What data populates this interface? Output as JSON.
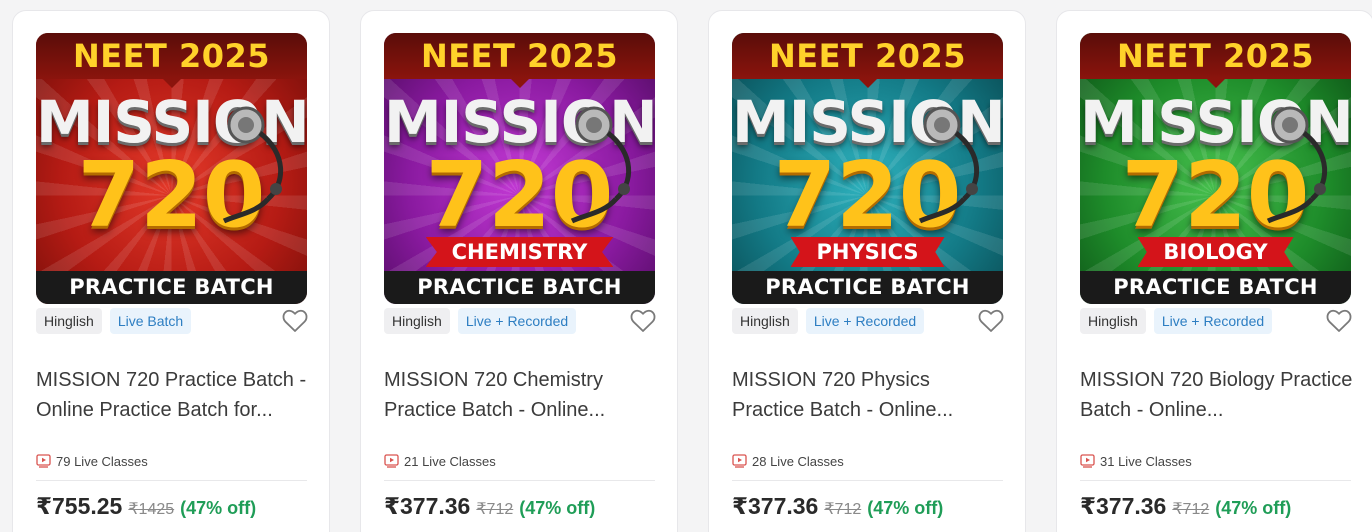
{
  "colors": {
    "card_1_theme": "#b51b14",
    "card_2_theme": "#8a1aa0",
    "card_3_theme": "#137a86",
    "card_4_theme": "#1e8c2a",
    "live_tag_text": "#2d7ec2",
    "discount_text": "#1f9d57"
  },
  "cards": [
    {
      "thumb": {
        "top": "NEET 2025",
        "line1": "MISSION",
        "line2": "720",
        "subject": "",
        "bottom": "PRACTICE BATCH"
      },
      "language_tag": "Hinglish",
      "mode_tag": "Live Batch",
      "title": "MISSION 720 Practice Batch - Online Practice Batch for...",
      "classes_icon": "video-play-icon",
      "classes": "79 Live Classes",
      "price": "₹755.25",
      "original_price": "₹1425",
      "discount": "(47% off)",
      "wishlist_icon": "heart-outline-icon"
    },
    {
      "thumb": {
        "top": "NEET 2025",
        "line1": "MISSION",
        "line2": "720",
        "subject": "CHEMISTRY",
        "bottom": "PRACTICE BATCH"
      },
      "language_tag": "Hinglish",
      "mode_tag": "Live + Recorded",
      "title": "MISSION 720 Chemistry Practice Batch - Online...",
      "classes_icon": "video-play-icon",
      "classes": "21 Live Classes",
      "price": "₹377.36",
      "original_price": "₹712",
      "discount": "(47% off)",
      "wishlist_icon": "heart-outline-icon"
    },
    {
      "thumb": {
        "top": "NEET 2025",
        "line1": "MISSION",
        "line2": "720",
        "subject": "PHYSICS",
        "bottom": "PRACTICE BATCH"
      },
      "language_tag": "Hinglish",
      "mode_tag": "Live + Recorded",
      "title": "MISSION 720 Physics Practice Batch - Online...",
      "classes_icon": "video-play-icon",
      "classes": "28 Live Classes",
      "price": "₹377.36",
      "original_price": "₹712",
      "discount": "(47% off)",
      "wishlist_icon": "heart-outline-icon"
    },
    {
      "thumb": {
        "top": "NEET 2025",
        "line1": "MISSION",
        "line2": "720",
        "subject": "BIOLOGY",
        "bottom": "PRACTICE BATCH"
      },
      "language_tag": "Hinglish",
      "mode_tag": "Live + Recorded",
      "title": "MISSION 720 Biology Practice Batch - Online...",
      "classes_icon": "video-play-icon",
      "classes": "31 Live Classes",
      "price": "₹377.36",
      "original_price": "₹712",
      "discount": "(47% off)",
      "wishlist_icon": "heart-outline-icon"
    }
  ]
}
